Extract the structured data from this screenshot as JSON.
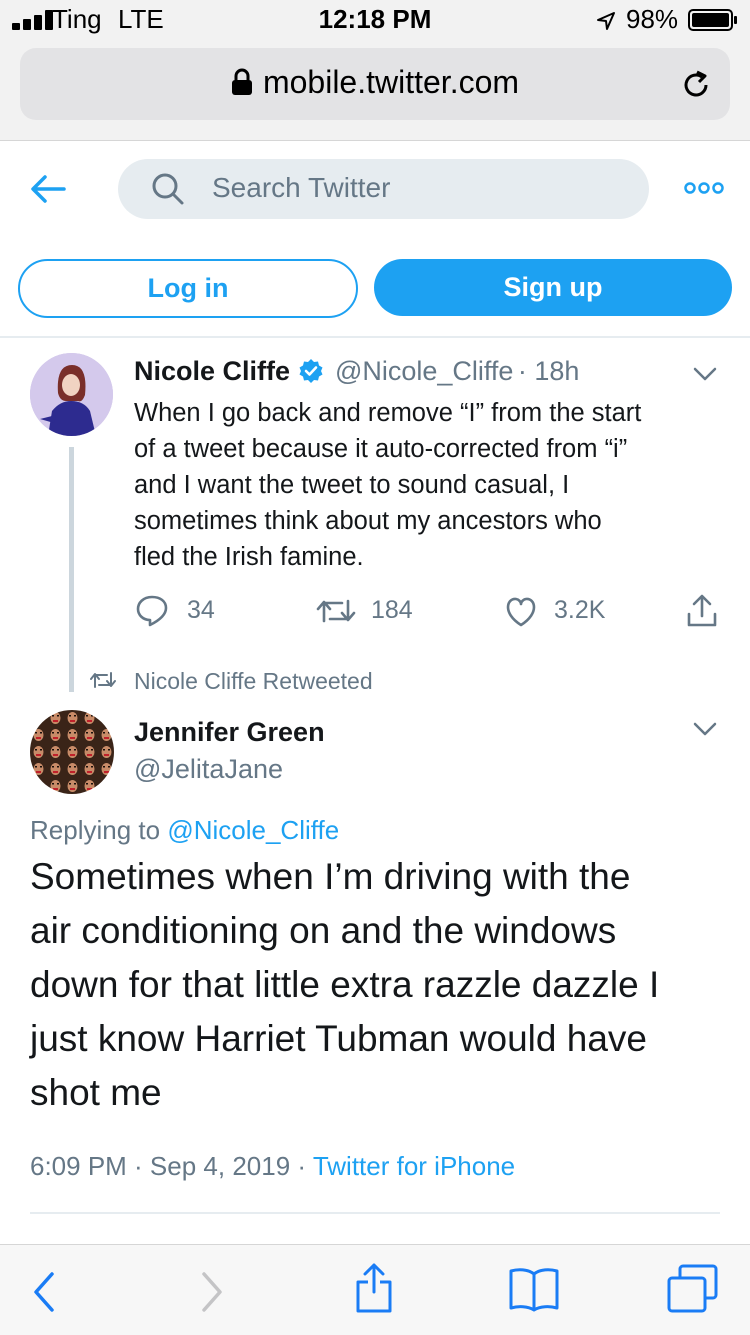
{
  "status_bar": {
    "carrier": "Ting",
    "network": "LTE",
    "time": "12:18 PM",
    "battery": "98%"
  },
  "browser": {
    "url": "mobile.twitter.com"
  },
  "header": {
    "search_placeholder": "Search Twitter"
  },
  "auth": {
    "login_label": "Log in",
    "signup_label": "Sign up"
  },
  "tweet1": {
    "name": "Nicole Cliffe",
    "handle": "@Nicole_Cliffe",
    "age": "· 18h",
    "text_lines": [
      "When I go back and remove “I” from the start",
      "of a tweet because it auto-corrected from “i”",
      "and I want the tweet to sound casual, I",
      "sometimes think about my ancestors who",
      "fled the Irish famine."
    ],
    "replies": "34",
    "retweets": "184",
    "likes": "3.2K"
  },
  "retweet_note": "Nicole Cliffe Retweeted",
  "tweet2": {
    "name": "Jennifer Green",
    "handle": "@JelitaJane",
    "replying_prefix": "Replying to ",
    "replying_to": "@Nicole_Cliffe",
    "text_lines": [
      "Sometimes when I’m driving with the",
      "air conditioning on and the windows",
      "down for that little extra razzle dazzle I",
      "just know Harriet Tubman would have",
      "shot me"
    ],
    "time": "6:09 PM · Sep 4, 2019 ·",
    "source": "Twitter for iPhone"
  },
  "icons": {
    "back": "arrow-left-icon",
    "search": "search-icon",
    "more": "more-icon",
    "verified": "verified-badge-icon",
    "chevron": "chevron-down-icon",
    "reply": "reply-icon",
    "retweet": "retweet-icon",
    "like": "heart-icon",
    "share": "share-icon"
  },
  "colors": {
    "accent": "#1da1f2",
    "muted": "#657786",
    "text": "#14171a"
  }
}
